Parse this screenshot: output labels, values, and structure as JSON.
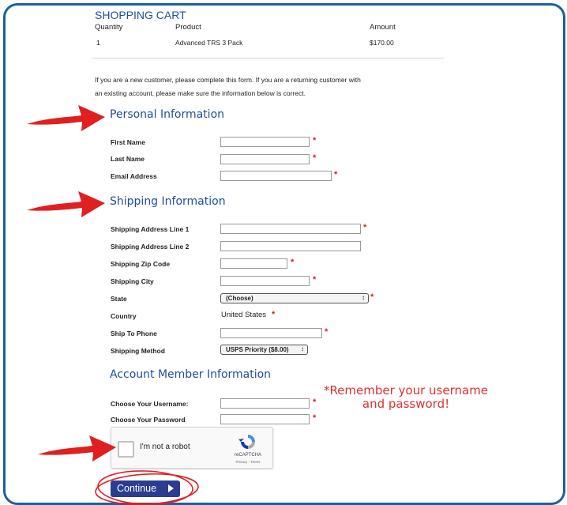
{
  "cart": {
    "title": "SHOPPING CART",
    "headers": {
      "quantity": "Quantity",
      "product": "Product",
      "amount": "Amount"
    },
    "row": {
      "quantity": "1",
      "product": "Advanced TRS 3 Pack",
      "amount": "$170.00"
    }
  },
  "intro": {
    "line1": "If you are a new customer, please complete this form.  If you are a returning customer with",
    "line2": "an existing account, please make sure the information below is correct."
  },
  "personal": {
    "heading": "Personal Information",
    "first_name": "First Name",
    "last_name": "Last Name",
    "email": "Email Address"
  },
  "shipping": {
    "heading": "Shipping Information",
    "address1": "Shipping Address Line 1",
    "address2": "Shipping Address Line 2",
    "zip": "Shipping Zip Code",
    "city": "Shipping City",
    "state_label": "State",
    "state_value": "(Choose)",
    "country_label": "Country",
    "country_value": "United States",
    "phone": "Ship To Phone",
    "method_label": "Shipping Method",
    "method_value": "USPS Priority ($8.00)"
  },
  "account": {
    "heading": "Account Member Information",
    "username": "Choose Your Username:",
    "password": "Choose Your Password"
  },
  "required_mark": "*",
  "annotation": {
    "line1": "*Remember your username",
    "line2": "and password!"
  },
  "captcha": {
    "label": "I'm not a robot",
    "brand": "reCAPTCHA",
    "terms": "Privacy - Terms"
  },
  "continue_label": "Continue",
  "colors": {
    "heading": "#1f4e99",
    "required": "#d62020",
    "annotation": "#e03030",
    "button": "#2a3d8f",
    "frame": "#1a5fa0"
  }
}
